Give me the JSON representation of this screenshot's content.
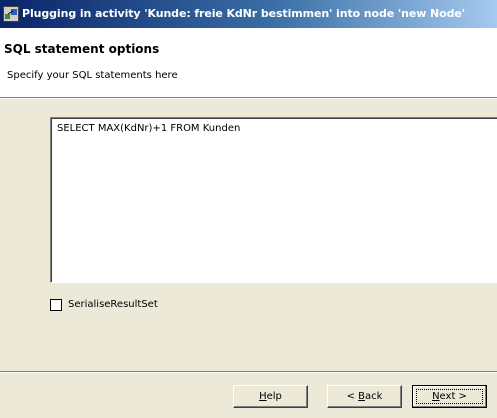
{
  "window": {
    "title": "Plugging in activity 'Kunde: freie KdNr bestimmen' into node 'new Node'",
    "icon": "plug-activity-icon"
  },
  "header": {
    "title": "SQL statement options",
    "subtitle": "Specify your SQL statements here"
  },
  "sql": {
    "value": "SELECT MAX(KdNr)+1 FROM Kunden"
  },
  "options": {
    "serialise_label": "SerialiseResultSet",
    "serialise_checked": false
  },
  "buttons": {
    "help": {
      "prefix": "",
      "mnemonic": "H",
      "suffix": "elp"
    },
    "back": {
      "prefix": "< ",
      "mnemonic": "B",
      "suffix": "ack"
    },
    "next": {
      "prefix": "",
      "mnemonic": "N",
      "suffix": "ext >"
    }
  },
  "colors": {
    "dialog_bg": "#ece9d8",
    "titlebar_start": "#0a246a",
    "titlebar_end": "#a6caf0"
  }
}
